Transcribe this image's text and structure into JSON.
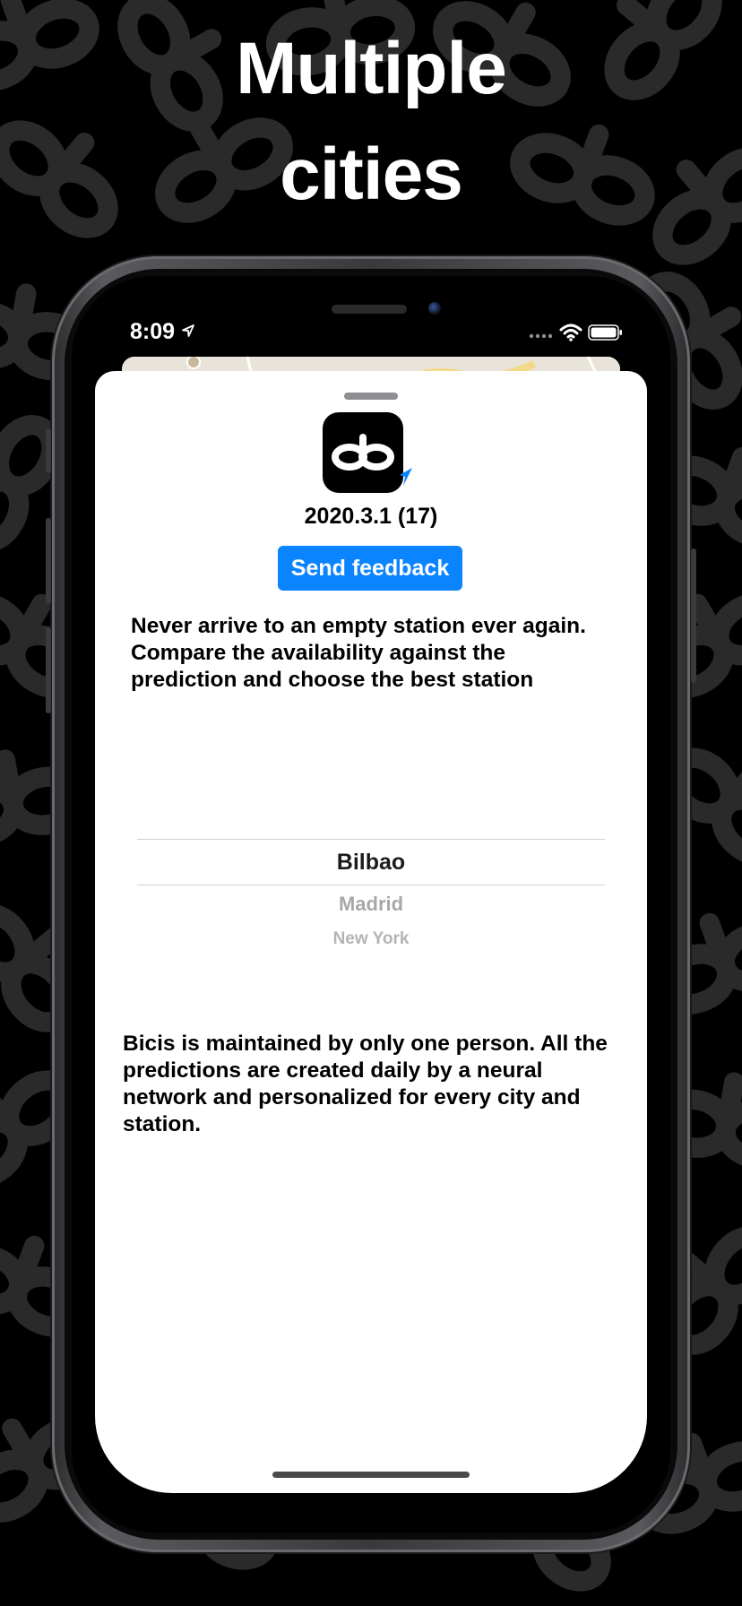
{
  "headline": {
    "line1": "Multiple",
    "line2": "cities"
  },
  "status_bar": {
    "time": "8:09",
    "location_icon": "location-arrow-icon",
    "signal_icon": "cellular-signal-icon",
    "wifi_icon": "wifi-icon",
    "battery_icon": "battery-icon"
  },
  "sheet": {
    "app_icon": "bicis-logo-icon",
    "version": "2020.3.1 (17)",
    "feedback_button": "Send feedback",
    "intro": "Never arrive to an empty station ever again. Compare the availability against the prediction and choose the best station",
    "city_picker": {
      "selected": "Bilbao",
      "options": [
        "Bilbao",
        "Madrid",
        "New York"
      ]
    },
    "footer": "Bicis is maintained by only one person. All the predictions are created daily by a neural network and personalized for every city and station."
  },
  "colors": {
    "background": "#000000",
    "accent": "#0A84FF",
    "sheet": "#FFFFFF",
    "pattern": "#2A2A2A"
  }
}
